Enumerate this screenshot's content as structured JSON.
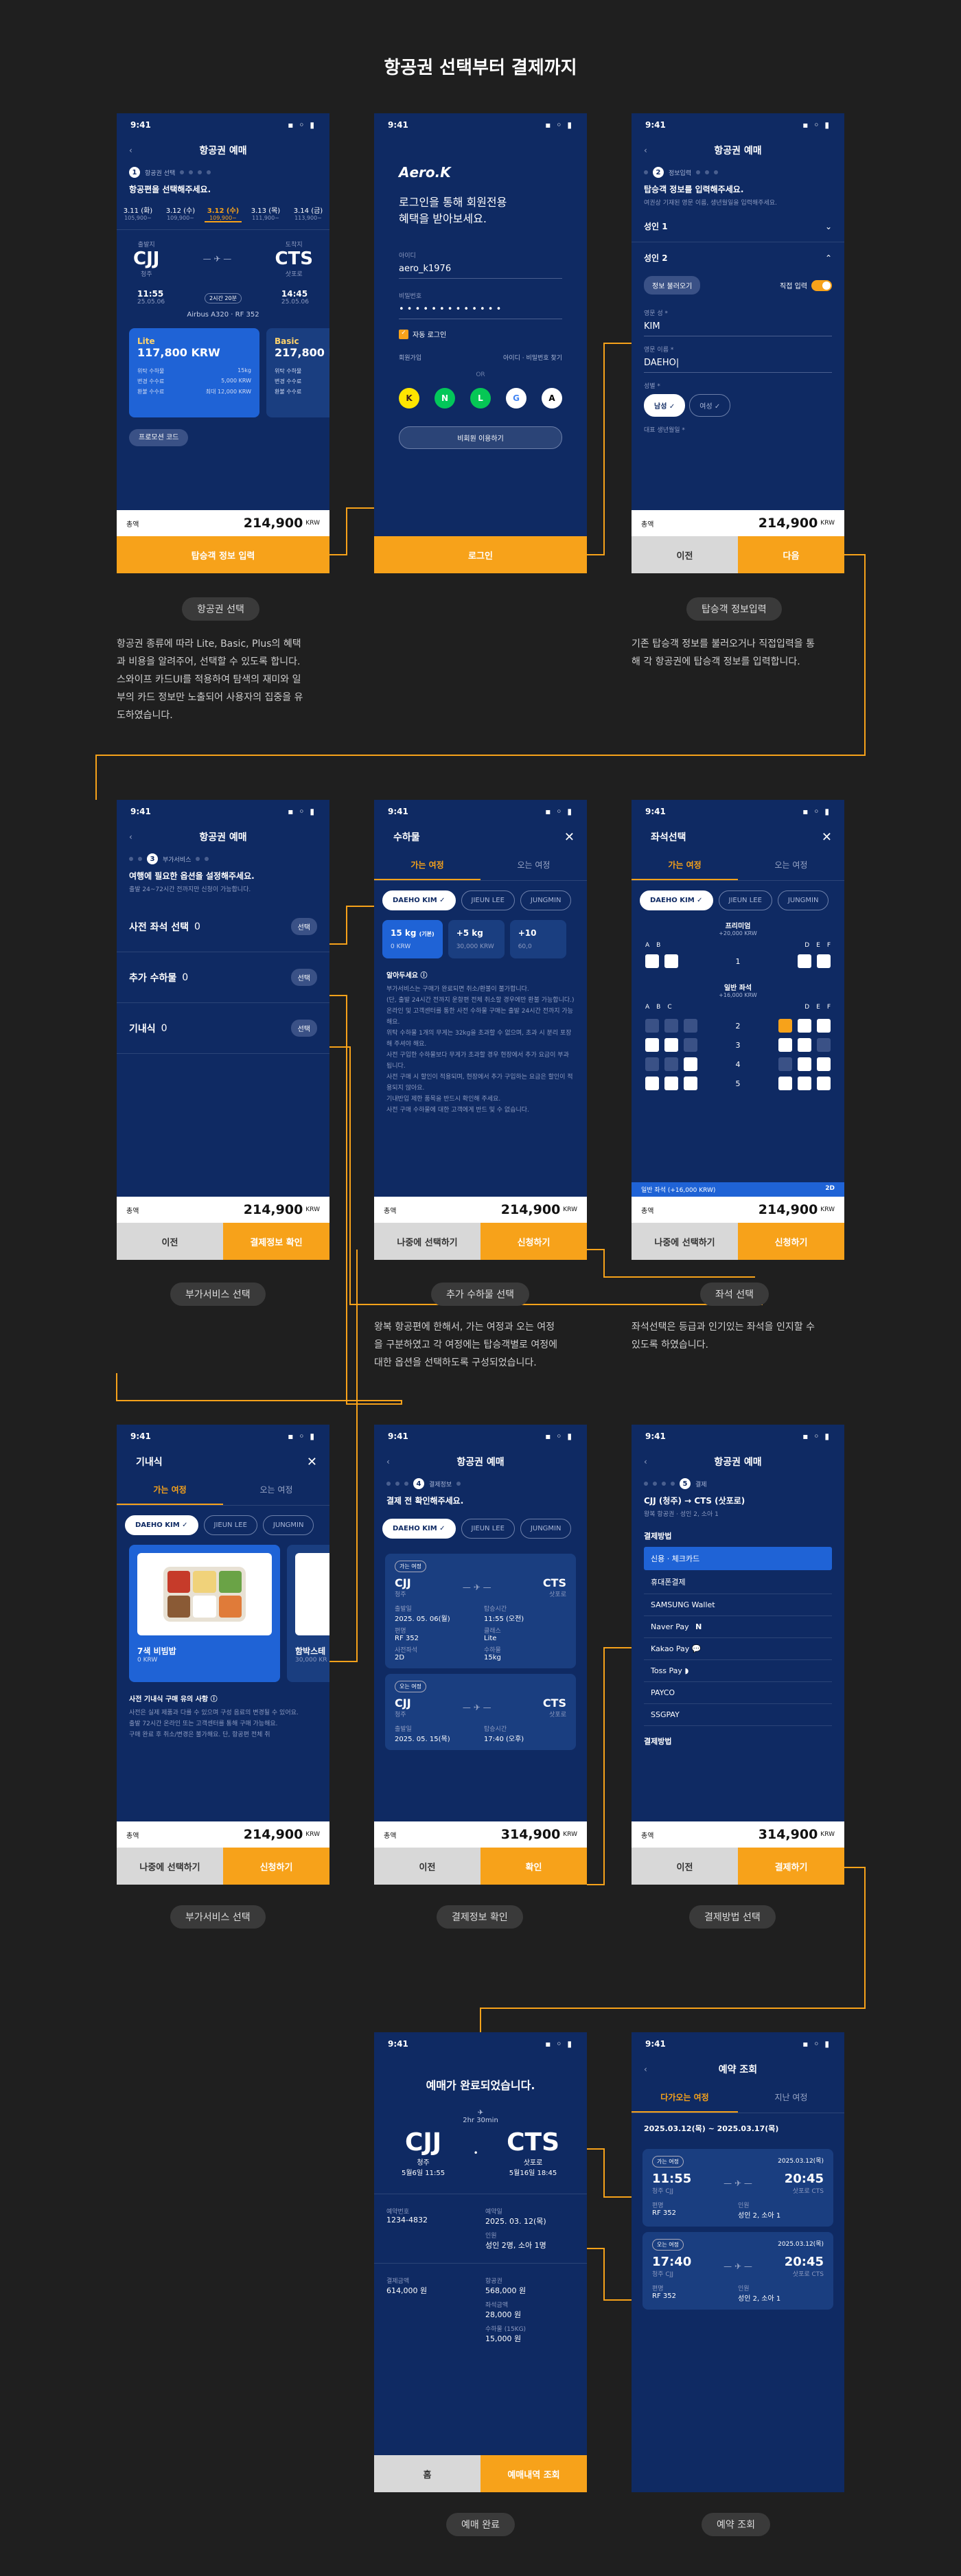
{
  "page_title": "항공권 선택부터 결제까지",
  "status": {
    "time": "9:41",
    "icons": "▪ ◦ ▮"
  },
  "s1": {
    "title": "항공권 예매",
    "step": "항공권 선택",
    "guide": "항공편을 선택해주세요.",
    "dates": [
      {
        "d": "3.11 (화)",
        "p": "105,900~"
      },
      {
        "d": "3.12 (수)",
        "p": "109,900~"
      },
      {
        "d": "3.12 (수)",
        "p": "109,900~"
      },
      {
        "d": "3.13 (목)",
        "p": "111,900~"
      },
      {
        "d": "3.14 (금)",
        "p": "113,900~"
      }
    ],
    "dep_label": "출발지",
    "arr_label": "도착지",
    "dep": "CJJ",
    "dep_city": "청주",
    "arr": "CTS",
    "arr_city": "삿포로",
    "dep_time": "11:55",
    "dep_date": "25.05.06",
    "arr_time": "14:45",
    "arr_date": "25.05.06",
    "dur": "2시간 20분",
    "aircraft": "Airbus A320",
    "flight": "RF 352",
    "fares": [
      {
        "name": "Lite",
        "price": "117,800 KRW",
        "r1": "위탁 수하물",
        "v1": "15kg",
        "r2": "변경 수수료",
        "v2": "5,000 KRW",
        "r3": "환불 수수료",
        "v3": "최대 12,000 KRW"
      },
      {
        "name": "Basic",
        "price": "217,800 KRW",
        "r1": "위탁 수하물",
        "r2": "변경 수수료",
        "r3": "환불 수수료"
      }
    ],
    "promo": "프로모션 코드",
    "total_label": "총액",
    "total": "214,900",
    "unit": "KRW",
    "cta": "탑승객 정보 입력"
  },
  "s2": {
    "brand": "Aero.K",
    "msg1": "로그인을 통해 회원전용",
    "msg2": "혜택을 받아보세요.",
    "id_label": "아이디",
    "id_value": "aero_k1976",
    "pw_label": "비밀번호",
    "pw_value": "• • • • • • • • • • • • •",
    "auto": "자동 로그인",
    "join": "회원가입",
    "find": "아이디 · 비밀번호 찾기",
    "or": "OR",
    "guest": "비회원 이용하기",
    "cta": "로그인",
    "socials": [
      "K",
      "N",
      "L",
      "G",
      "A"
    ]
  },
  "s3": {
    "title": "항공권 예매",
    "step": "정보입력",
    "guide": "탑승객 정보를 입력해주세요.",
    "sub": "여권상 기재된 영문 이름, 생년월일을 입력해주세요.",
    "p1": "성인 1",
    "p2": "성인 2",
    "load": "정보 불러오기",
    "direct": "직접 입력",
    "last_label": "영문 성 *",
    "last": "KIM",
    "first_label": "영문 이름 *",
    "first": "DAEHO|",
    "gender_label": "성별 *",
    "male": "남성 ✓",
    "female": "여성 ✓",
    "birth_label": "대표 생년월일 *",
    "total": "214,900",
    "prev": "이전",
    "next": "다음"
  },
  "s4": {
    "title": "항공권 예매",
    "step": "부가서비스",
    "guide": "여행에 필요한 옵션을 설정해주세요.",
    "sub": "출발 24~72시간 전까지만 신청이 가능합니다.",
    "rows": [
      {
        "label": "사전 좌석 선택",
        "count": "0",
        "btn": "선택"
      },
      {
        "label": "추가 수하물",
        "count": "0",
        "btn": "선택"
      },
      {
        "label": "기내식",
        "count": "0",
        "btn": "선택"
      }
    ],
    "total": "214,900",
    "prev": "이전",
    "cta": "결제정보 확인"
  },
  "s5": {
    "title": "수하물",
    "tabs": [
      "가는 여정",
      "오는 여정"
    ],
    "chips": [
      "DAEHO KIM ✓",
      "JIEUN LEE",
      "JUNGMIN"
    ],
    "bags": [
      {
        "w": "15 kg",
        "tag": "(기본)",
        "p": "0 KRW"
      },
      {
        "w": "+5 kg",
        "p": "30,000 KRW"
      },
      {
        "w": "+10",
        "p": "60,0"
      }
    ],
    "notice_title": "알아두세요 ⓘ",
    "notices": [
      "부가서비스는 구매가 완료되면 취소/환불이 불가합니다.",
      "(단, 출발 24시간 전까지 운항편 전체 취소할 경우에만 환불 가능합니다.)",
      "온라인 및 고객센터를 통한 사전 수하물 구매는 출발 24시간 전까지 가능해요.",
      "위탁 수하물 1개의 무게는 32kg을 초과할 수 없으며, 초과 시 분리 포장해 주셔야 해요.",
      "사전 구입한 수하물보다 무게가 초과할 경우 현장에서 추가 요금이 부과됩니다.",
      "사전 구매 시 할인이 적용되며, 현장에서 추가 구입하는 요금은 할인이 적용되지 않아요.",
      "기내반입 제한 품목을 반드시 확인해 주세요.",
      "사전 구매 수하물에 대한 고객에게 반드 및 수 없습니다."
    ],
    "total": "214,900",
    "later": "나중에 선택하기",
    "cta": "신청하기"
  },
  "s6": {
    "title": "좌석선택",
    "tabs": [
      "가는 여정",
      "오는 여정"
    ],
    "chips": [
      "DAEHO KIM ✓",
      "JIEUN LEE",
      "JUNGMIN"
    ],
    "premium": "프리미엄",
    "premium_price": "+20,000 KRW",
    "std": "일반 좌석",
    "std_price": "+16,000 KRW",
    "cols": [
      "A",
      "B",
      "C",
      "D",
      "E",
      "F"
    ],
    "rows": [
      "1",
      "2",
      "3",
      "4",
      "5"
    ],
    "selected_label": "일반 좌석 (+16,000 KRW)",
    "selected_seat": "2D",
    "total": "214,900",
    "later": "나중에 선택하기",
    "cta": "신청하기"
  },
  "s7": {
    "title": "기내식",
    "tabs": [
      "가는 여정",
      "오는 여정"
    ],
    "chips": [
      "DAEHO KIM ✓",
      "JIEUN LEE",
      "JUNGMIN"
    ],
    "meal1": "7색 비빔밥",
    "meal1_price": "0 KRW",
    "meal2": "함박스테",
    "meal2_price": "30,000 KR",
    "notice_title": "사전 기내식 구매 유의 사항 ⓘ",
    "notices": [
      "사전은 실제 제품과 다를 수 있으며 구성 음료의 변경될 수 있어요.",
      "출발 72시간 온라인 또는 고객센터를 통해 구매 가능해요.",
      "구매 완료 후 취소/변경은 불가해요. 단, 항공편 전체 취"
    ],
    "total": "214,900",
    "later": "나중에 선택하기",
    "cta": "신청하기"
  },
  "s8": {
    "title": "항공권 예매",
    "step": "결제정보",
    "guide": "결제 전 확인해주세요.",
    "chips": [
      "DAEHO KIM ✓",
      "JIEUN LEE",
      "JUNGMIN"
    ],
    "legs": [
      {
        "tag": "가는 여정",
        "dep": "CJJ",
        "dep_city": "청주",
        "arr": "CTS",
        "arr_city": "삿포로",
        "c1": "출발일",
        "v1": "2025. 05. 06(월)",
        "c2": "탑승시간",
        "v2": "11:55 (오전)",
        "c3": "편명",
        "v3": "RF 352",
        "c4": "클래스",
        "v4": "Lite",
        "c5": "사전좌석",
        "v5": "2D",
        "c6": "수하물",
        "v6": "15kg"
      },
      {
        "tag": "오는 여정",
        "dep": "CJJ",
        "dep_city": "청주",
        "arr": "CTS",
        "arr_city": "삿포로",
        "c1": "출발일",
        "v1": "2025. 05. 15(목)",
        "c2": "탑승시간",
        "v2": "17:40 (오후)"
      }
    ],
    "total": "314,900",
    "prev": "이전",
    "cta": "확인"
  },
  "s9": {
    "title": "항공권 예매",
    "step": "결제",
    "route": "CJJ (청주) → CTS (삿포로)",
    "route_sub": "왕복 항공권 · 성인 2, 소아 1",
    "method_label": "결제방법",
    "methods": [
      "신용 · 체크카드",
      "휴대폰결제",
      "SAMSUNG Wallet",
      "Naver Pay",
      "Kakao Pay",
      "Toss Pay",
      "PAYCO",
      "SSGPAY"
    ],
    "method_label2": "결제방법",
    "total": "314,900",
    "prev": "이전",
    "cta": "결제하기"
  },
  "s10": {
    "done": "예매가 완료되었습니다.",
    "dur": "2hr 30min",
    "dep": "CJJ",
    "dep_city": "청주",
    "dep_dt": "5월6일 11:55",
    "arr": "CTS",
    "arr_city": "삿포로",
    "arr_dt": "5월16일 18:45",
    "f": [
      {
        "l": "예약번호",
        "v": "1234-4832"
      },
      {
        "l": "예약일",
        "v": "2025. 03. 12(목)"
      },
      {
        "l": "",
        "v": ""
      },
      {
        "l": "인원",
        "v": "성인 2명, 소아 1명"
      },
      {
        "l": "결제금액",
        "v": "614,000 원"
      },
      {
        "l": "항공권",
        "v": "568,000 원"
      },
      {
        "l": "",
        "v": ""
      },
      {
        "l": "좌석금액",
        "v": "28,000 원"
      },
      {
        "l": "",
        "v": ""
      },
      {
        "l": "수하물 (15KG)",
        "v": "15,000 원"
      }
    ],
    "home": "홈",
    "cta": "예매내역 조회"
  },
  "s11": {
    "title": "예약 조회",
    "tabs": [
      "다가오는 여정",
      "지난 여정"
    ],
    "range": "2025.03.12(목) ~ 2025.03.17(목)",
    "cards": [
      {
        "tag": "가는 여정",
        "date": "2025.03.12(목)",
        "t1": "11:55",
        "c1": "청주 CJJ",
        "t2": "20:45",
        "c2": "삿포로 CTS",
        "l1": "편명",
        "v1": "RF 352",
        "l2": "인원",
        "v2": "성인 2, 소아 1"
      },
      {
        "tag": "오는 여정",
        "date": "2025.03.12(목)",
        "t1": "17:40",
        "c1": "청주 CJJ",
        "t2": "20:45",
        "c2": "삿포로 CTS",
        "l1": "편명",
        "v1": "RF 352",
        "l2": "인원",
        "v2": "성인 2, 소아 1"
      }
    ]
  },
  "captions": {
    "c1": "항공권 선택",
    "c3": "탑승객 정보입력",
    "c4": "부가서비스 선택",
    "c5": "추가 수하물 선택",
    "c6": "좌석 선택",
    "c7": "부가서비스 선택",
    "c8": "결제정보 확인",
    "c9": "결제방법 선택",
    "c10": "예매 완료",
    "c11": "예약 조회"
  },
  "descs": {
    "d1": [
      "항공권 종류에 따라 Lite, Basic, Plus의 혜택",
      "과 비용을 알려주어, 선택할 수 있도록 합니다.",
      "스와이프 카드UI를 적용하여 탐색의 재미와 일",
      "부의 카드 정보만 노출되어 사용자의 집중을 유",
      "도하였습니다."
    ],
    "d3": [
      "기존 탑승객 정보를 불러오거나 직접입력을 통",
      "해 각 항공권에 탑승객 정보를 입력합니다."
    ],
    "d5": [
      "왕복 항공편에 한해서, 가는 여정과 오는 여정",
      "을 구분하였고 각 여정에는 탑승객별로 여정에",
      "대한 옵션을 선택하도록 구성되었습니다."
    ],
    "d6": [
      "좌석선택은 등급과 인기있는 좌석을 인지할 수",
      "있도록 하였습니다."
    ]
  },
  "colors": {
    "bg": "#1f1f1f",
    "navy": "#0f2a63",
    "accent": "#f7a21a"
  }
}
